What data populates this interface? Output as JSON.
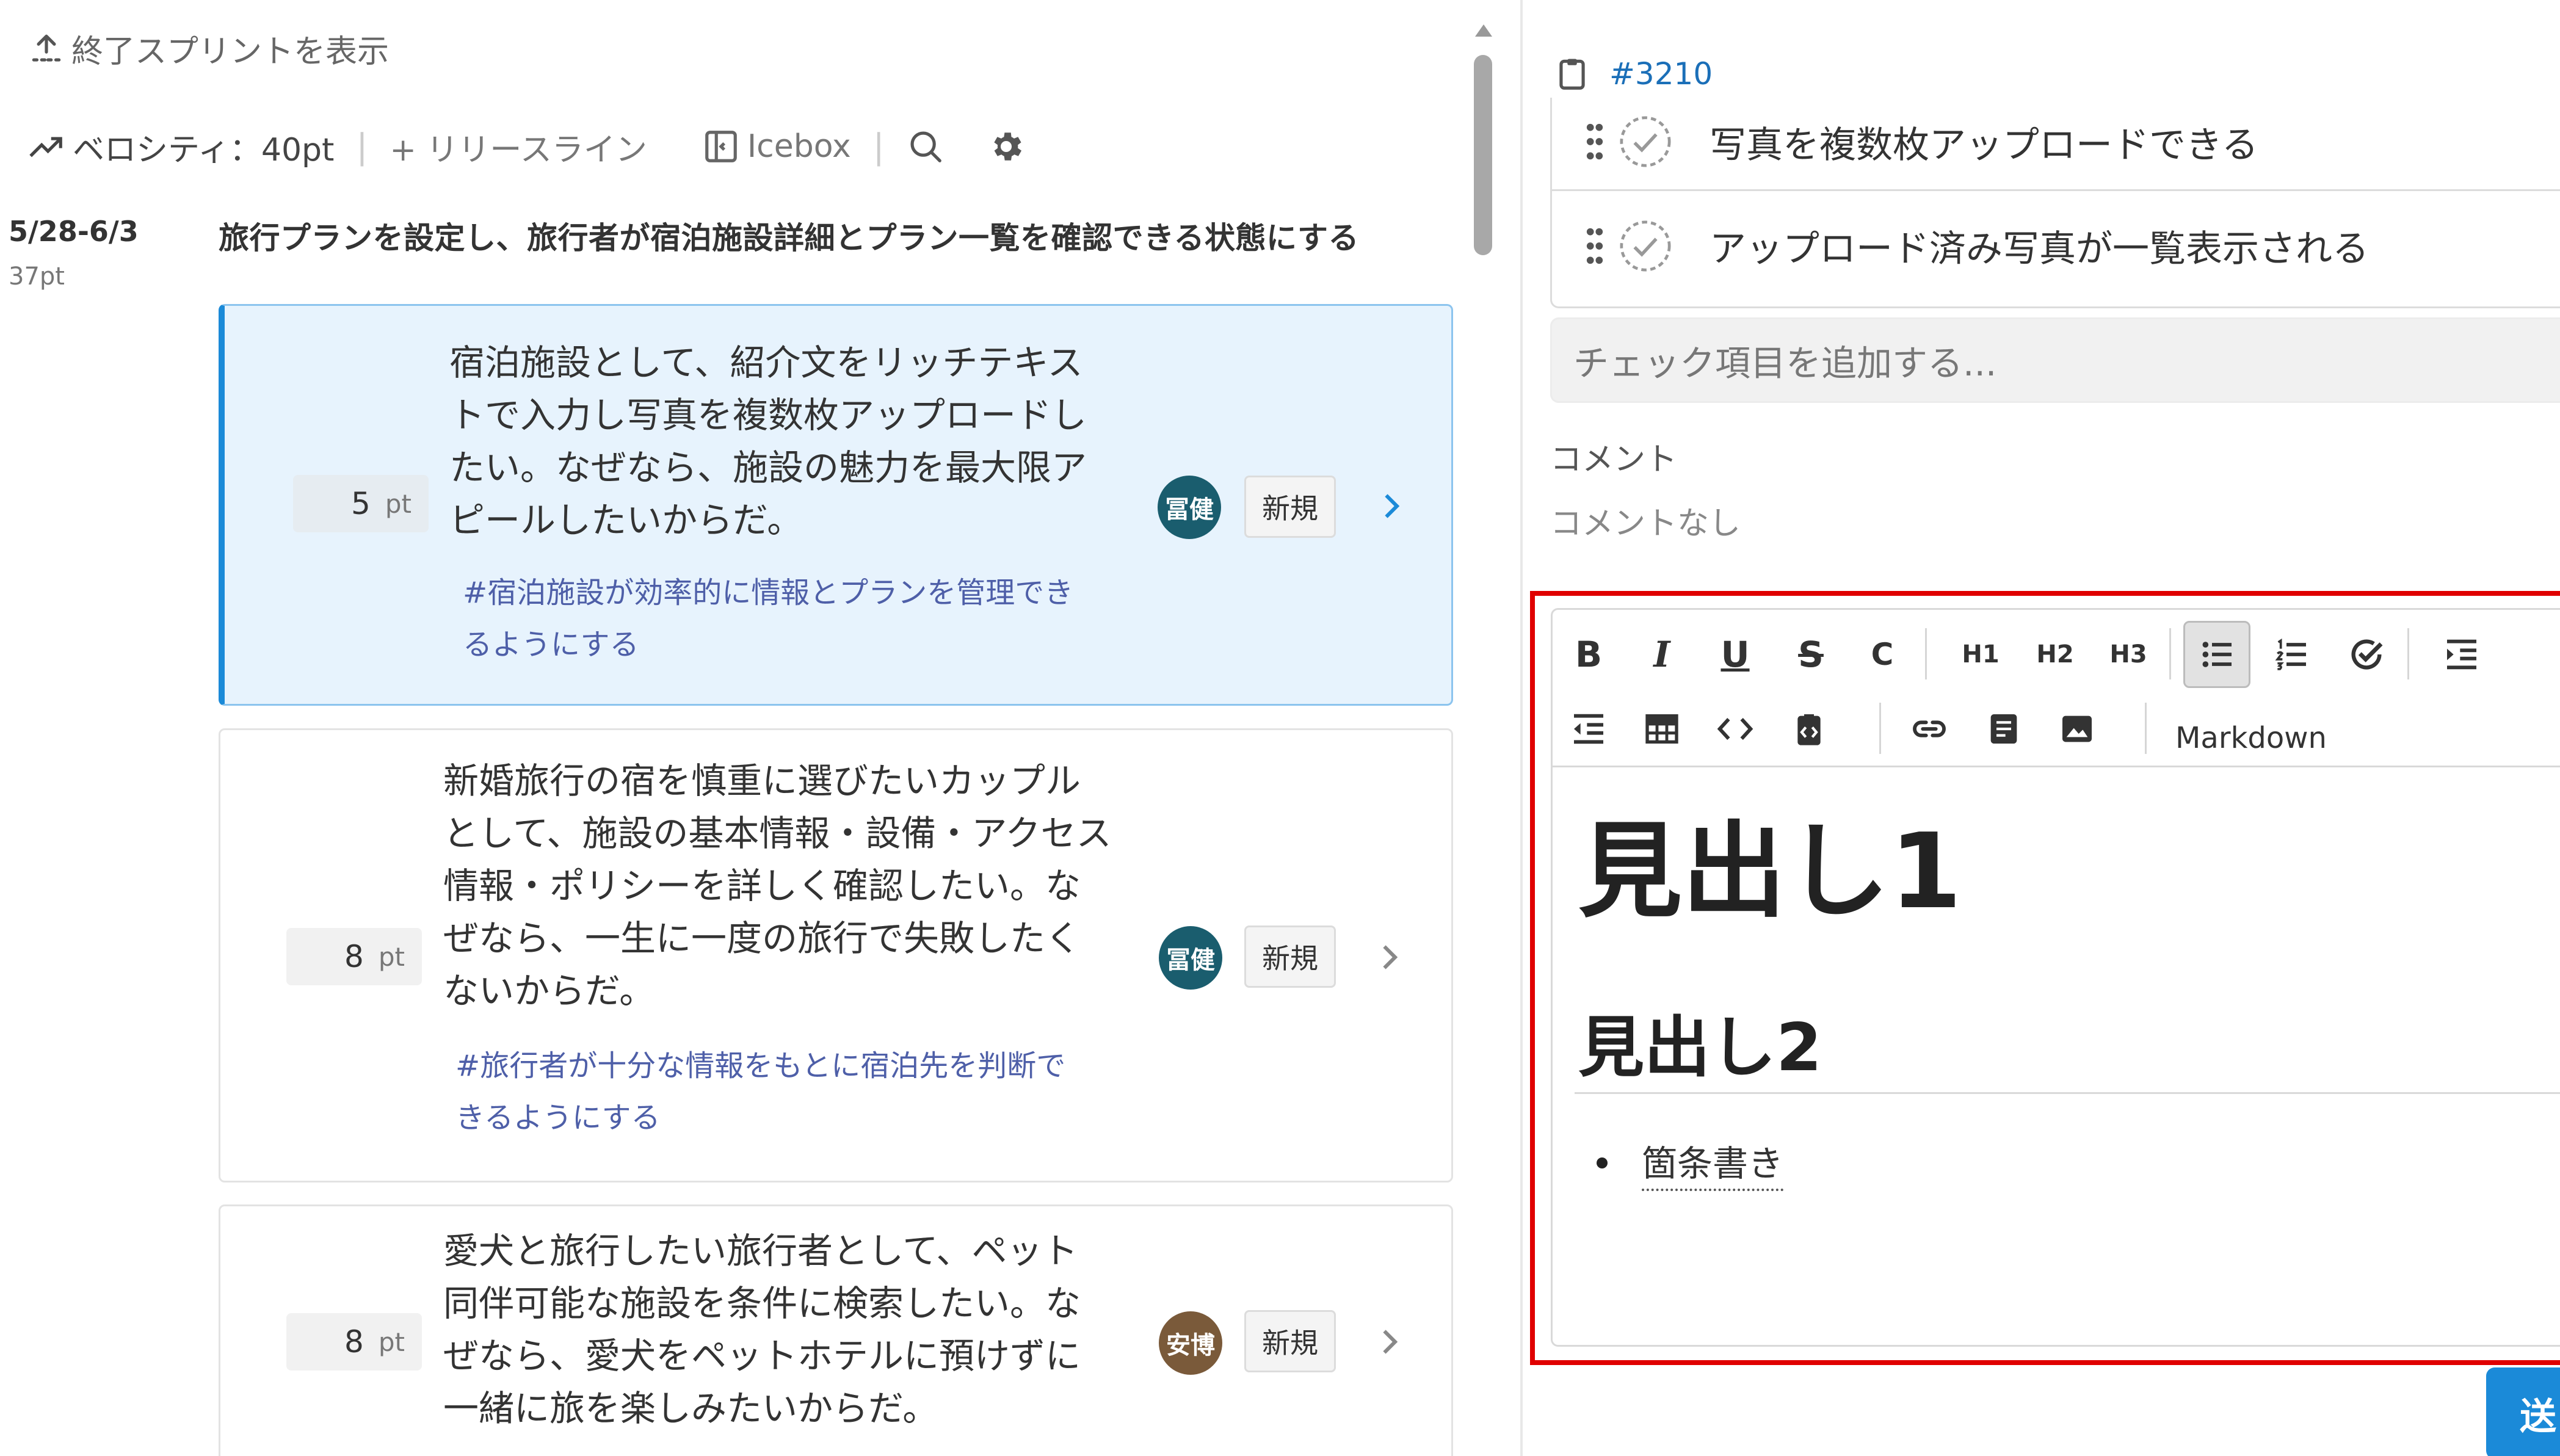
{
  "left": {
    "show_ended_label": "終了スプリントを表示",
    "toolbar": {
      "velocity_label": "ベロシティ：40pt",
      "release_line_label": "+ リリースライン",
      "icebox_label": "Icebox"
    },
    "sprint": {
      "date_range": "5/28-6/3",
      "points": "37pt",
      "goal": "旅行プランを設定し、旅行者が宿泊施設詳細とプラン一覧を確認できる状態にする"
    },
    "pt_unit": "pt",
    "cards": [
      {
        "points": "5",
        "story_lines": [
          "宿泊施設として、紹介文をリッチテキス",
          "トで入力し写真を複数枚アップロードし",
          "たい。なぜなら、施設の魅力を最大限ア",
          "ピールしたいからだ。"
        ],
        "epic_lines": [
          "#宿泊施設が効率的に情報とプランを管理でき",
          "るようにする"
        ],
        "assignee": "冨健",
        "assignee_color": "#1a5d6e",
        "status": "新規",
        "selected": true
      },
      {
        "points": "8",
        "story_lines": [
          "新婚旅行の宿を慎重に選びたいカップル",
          "として、施設の基本情報・設備・アクセス",
          "情報・ポリシーを詳しく確認したい。な",
          "ぜなら、一生に一度の旅行で失敗したく",
          "ないからだ。"
        ],
        "epic_lines": [
          "#旅行者が十分な情報をもとに宿泊先を判断で",
          "きるようにする"
        ],
        "assignee": "冨健",
        "assignee_color": "#1a5d6e",
        "status": "新規",
        "selected": false
      },
      {
        "points": "8",
        "story_lines": [
          "愛犬と旅行したい旅行者として、ペット",
          "同伴可能な施設を条件に検索したい。な",
          "ぜなら、愛犬をペットホテルに預けずに",
          "一緒に旅を楽しみたいからだ。"
        ],
        "epic_lines": [],
        "assignee": "安博",
        "assignee_color": "#7a5a3a",
        "status": "新規",
        "selected": false
      }
    ]
  },
  "right": {
    "issue_id": "#3210",
    "checklist": [
      {
        "label": "写真を複数枚アップロードできる"
      },
      {
        "label": "アップロード済み写真が一覧表示される"
      }
    ],
    "add_check_placeholder": "チェック項目を追加する...",
    "comment_heading": "コメント",
    "comment_empty": "コメントなし",
    "editor": {
      "toolbar": {
        "bold": "B",
        "italic": "I",
        "underline": "U",
        "strike": "S",
        "code_inline": "C",
        "h1": "H1",
        "h2": "H2",
        "h3": "H3",
        "markdown_label": "Markdown"
      },
      "content": {
        "h1": "見出し1",
        "h2": "見出し2",
        "bullet": "箇条書き"
      }
    },
    "send_label": "送"
  }
}
